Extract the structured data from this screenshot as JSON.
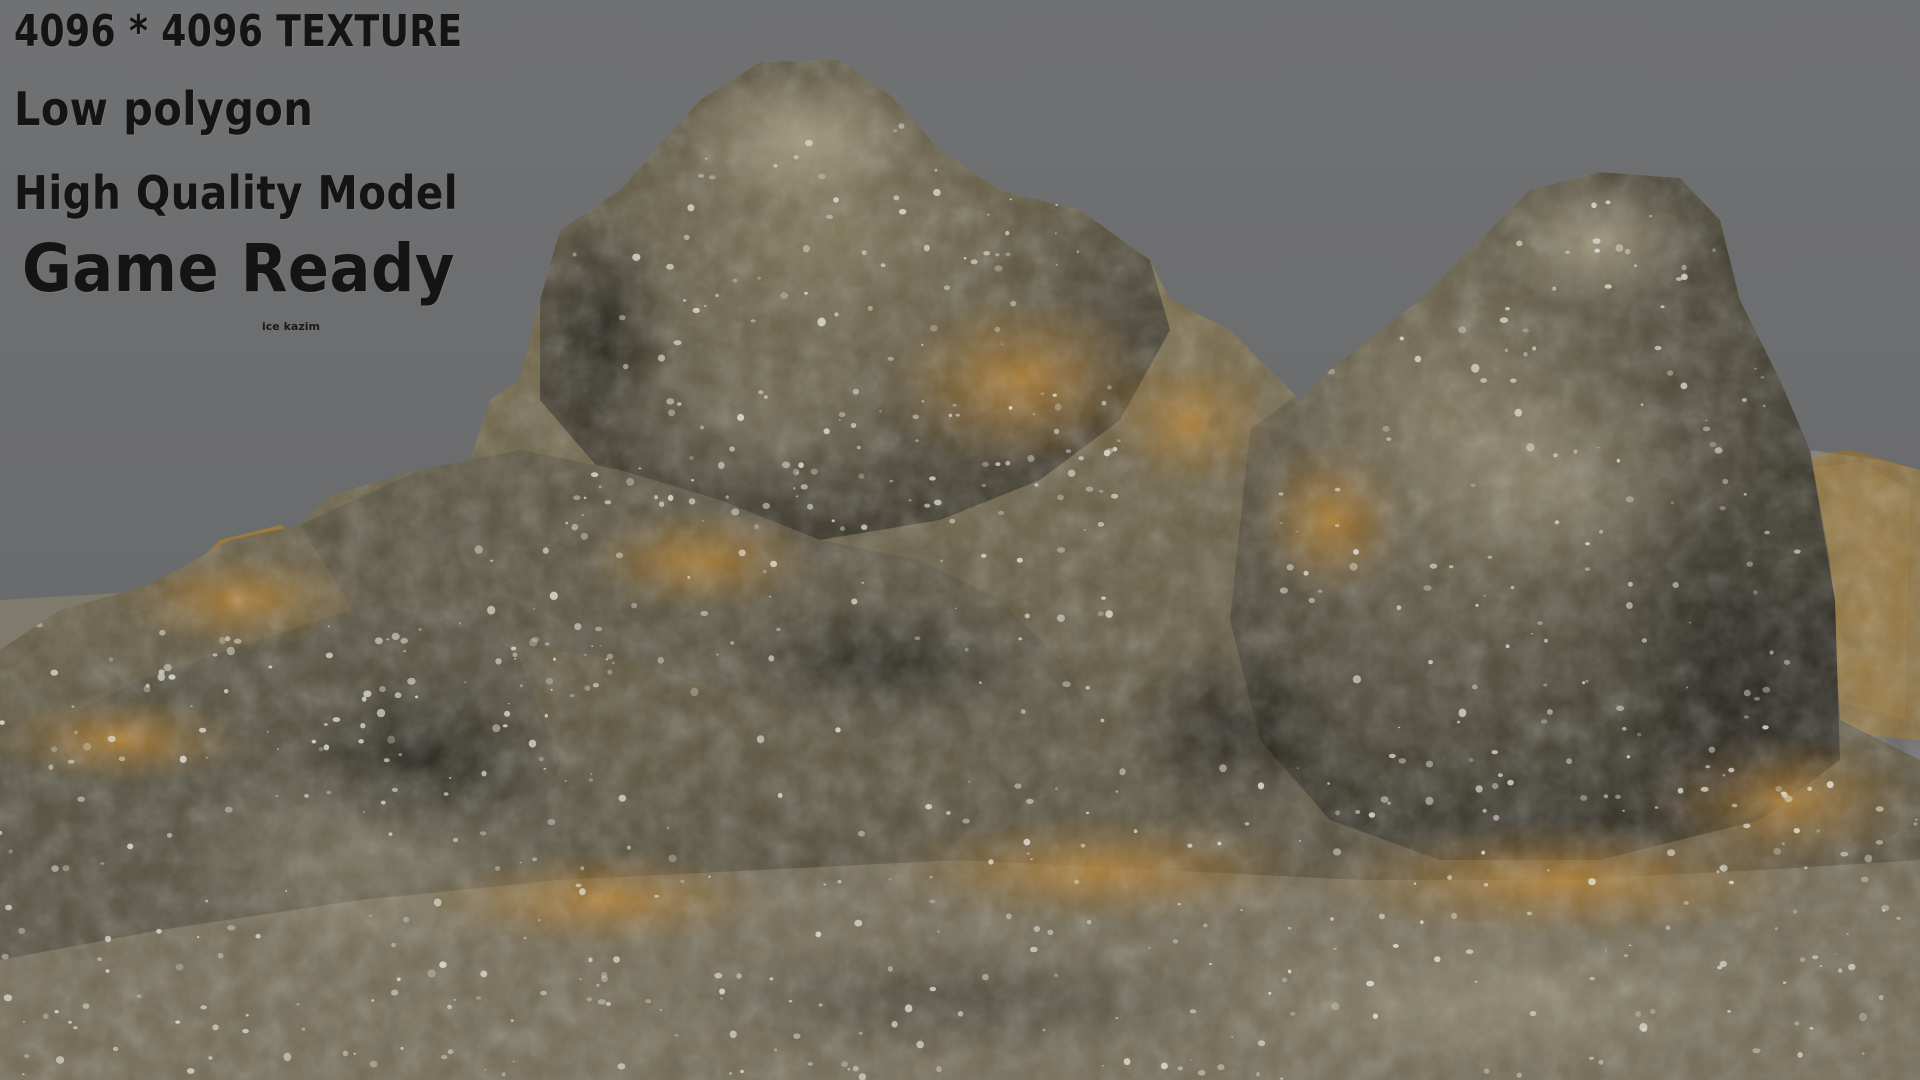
{
  "overlay": {
    "line1": "4096 * 4096 TEXTURE",
    "line2": "Low polygon",
    "line3": "High Quality Model",
    "line4": "Game Ready",
    "credit": "ice kazim"
  },
  "scene": {
    "subject": "rock-formation-render",
    "background_color": "#6b6c6e",
    "rock_colors": [
      "#4a4534",
      "#6b6248",
      "#8a7a52",
      "#3a3628",
      "#a38a4e"
    ],
    "moss_color": "#b07a2a",
    "lichen_color": "#e8e6dc"
  }
}
